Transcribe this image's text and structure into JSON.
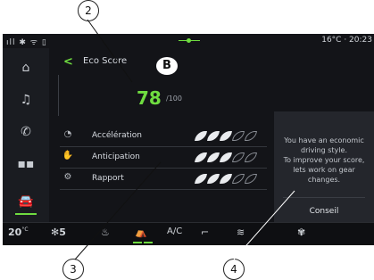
{
  "status": {
    "signal": "ᵍᵍ ∗ ≡ ▯",
    "right": "16°C · 20:23"
  },
  "header": {
    "title": "Eco Score",
    "badge": "B"
  },
  "score": {
    "value": "78",
    "max": "/100"
  },
  "criteria": [
    {
      "label": "Accélération",
      "icon": "speedometer-icon",
      "level": 3,
      "total": 5
    },
    {
      "label": "Anticipation",
      "icon": "anticipation-icon",
      "level": 3,
      "total": 5
    },
    {
      "label": "Rapport",
      "icon": "gear-icon",
      "level": 3,
      "total": 5
    }
  ],
  "panel": {
    "text": "You have an economic driving style.\nTo improve your score, lets work on gear changes.",
    "button": "Conseil"
  },
  "climate": {
    "temp": "20",
    "temp_unit": "°C",
    "fan": "5",
    "ac": "A/C"
  },
  "callouts": {
    "c2": "2",
    "c3": "3",
    "c4": "4"
  },
  "colors": {
    "accent": "#6fdc40",
    "screen": "#131418"
  }
}
